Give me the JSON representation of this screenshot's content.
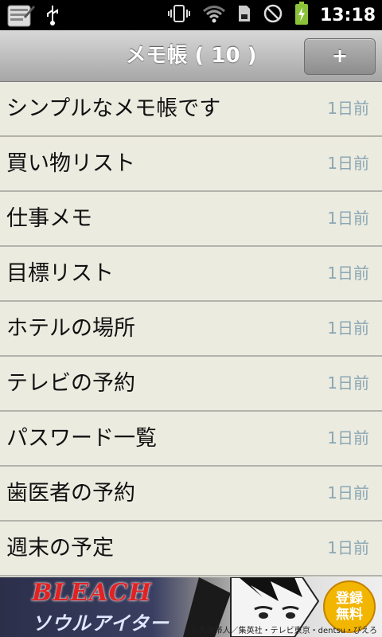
{
  "statusbar": {
    "time": "13:18",
    "icons": [
      "notes-app-icon",
      "usb-icon",
      "vibrate-icon",
      "wifi-icon",
      "sd-card-icon",
      "no-signal-icon",
      "battery-charging-icon"
    ]
  },
  "header": {
    "title": "メモ帳 ( 10 )",
    "add_label": "+"
  },
  "notes": [
    {
      "title": "シンプルなメモ帳です",
      "time": "1日前"
    },
    {
      "title": "買い物リスト",
      "time": "1日前"
    },
    {
      "title": "仕事メモ",
      "time": "1日前"
    },
    {
      "title": "目標リスト",
      "time": "1日前"
    },
    {
      "title": "ホテルの場所",
      "time": "1日前"
    },
    {
      "title": "テレビの予約",
      "time": "1日前"
    },
    {
      "title": "パスワード一覧",
      "time": "1日前"
    },
    {
      "title": "歯医者の予約",
      "time": "1日前"
    },
    {
      "title": "週末の予定",
      "time": "1日前"
    }
  ],
  "ad": {
    "logo": "BLEACH",
    "subtitle": "ソウルアイター",
    "badge_line1": "登録",
    "badge_line2": "無料",
    "credit": "©久保帯人／集英社・テレビ東京・dentsu・ぴえろ"
  },
  "colors": {
    "background": "#ecebe0",
    "timestamp": "#8aa7b3",
    "divider": "#b3b3ac"
  }
}
